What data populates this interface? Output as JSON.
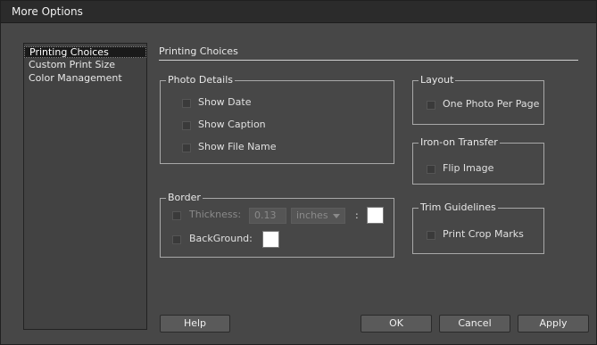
{
  "window": {
    "title": "More Options"
  },
  "sidebar": {
    "items": [
      {
        "label": "Printing Choices",
        "selected": true
      },
      {
        "label": "Custom Print Size"
      },
      {
        "label": "Color Management"
      }
    ]
  },
  "main": {
    "section_title": "Printing Choices",
    "photo_details": {
      "legend": "Photo Details",
      "show_date": {
        "label": "Show Date",
        "checked": false
      },
      "show_caption": {
        "label": "Show Caption",
        "checked": false
      },
      "show_file_name": {
        "label": "Show File Name",
        "checked": false
      }
    },
    "border": {
      "legend": "Border",
      "thickness": {
        "label": "Thickness:",
        "value": "0.13",
        "unit": "inches",
        "separator": ":"
      },
      "background": {
        "label": "BackGround:"
      }
    },
    "layout": {
      "legend": "Layout",
      "one_photo": {
        "label": "One Photo Per Page",
        "checked": false
      }
    },
    "iron_on": {
      "legend": "Iron-on Transfer",
      "flip": {
        "label": "Flip Image",
        "checked": false
      }
    },
    "trim": {
      "legend": "Trim Guidelines",
      "crop_marks": {
        "label": "Print Crop Marks",
        "checked": false
      }
    }
  },
  "buttons": {
    "help": "Help",
    "ok": "OK",
    "cancel": "Cancel",
    "apply": "Apply"
  },
  "colors": {
    "background_swatch": "#ffffff",
    "border_swatch": "#ffffff"
  }
}
